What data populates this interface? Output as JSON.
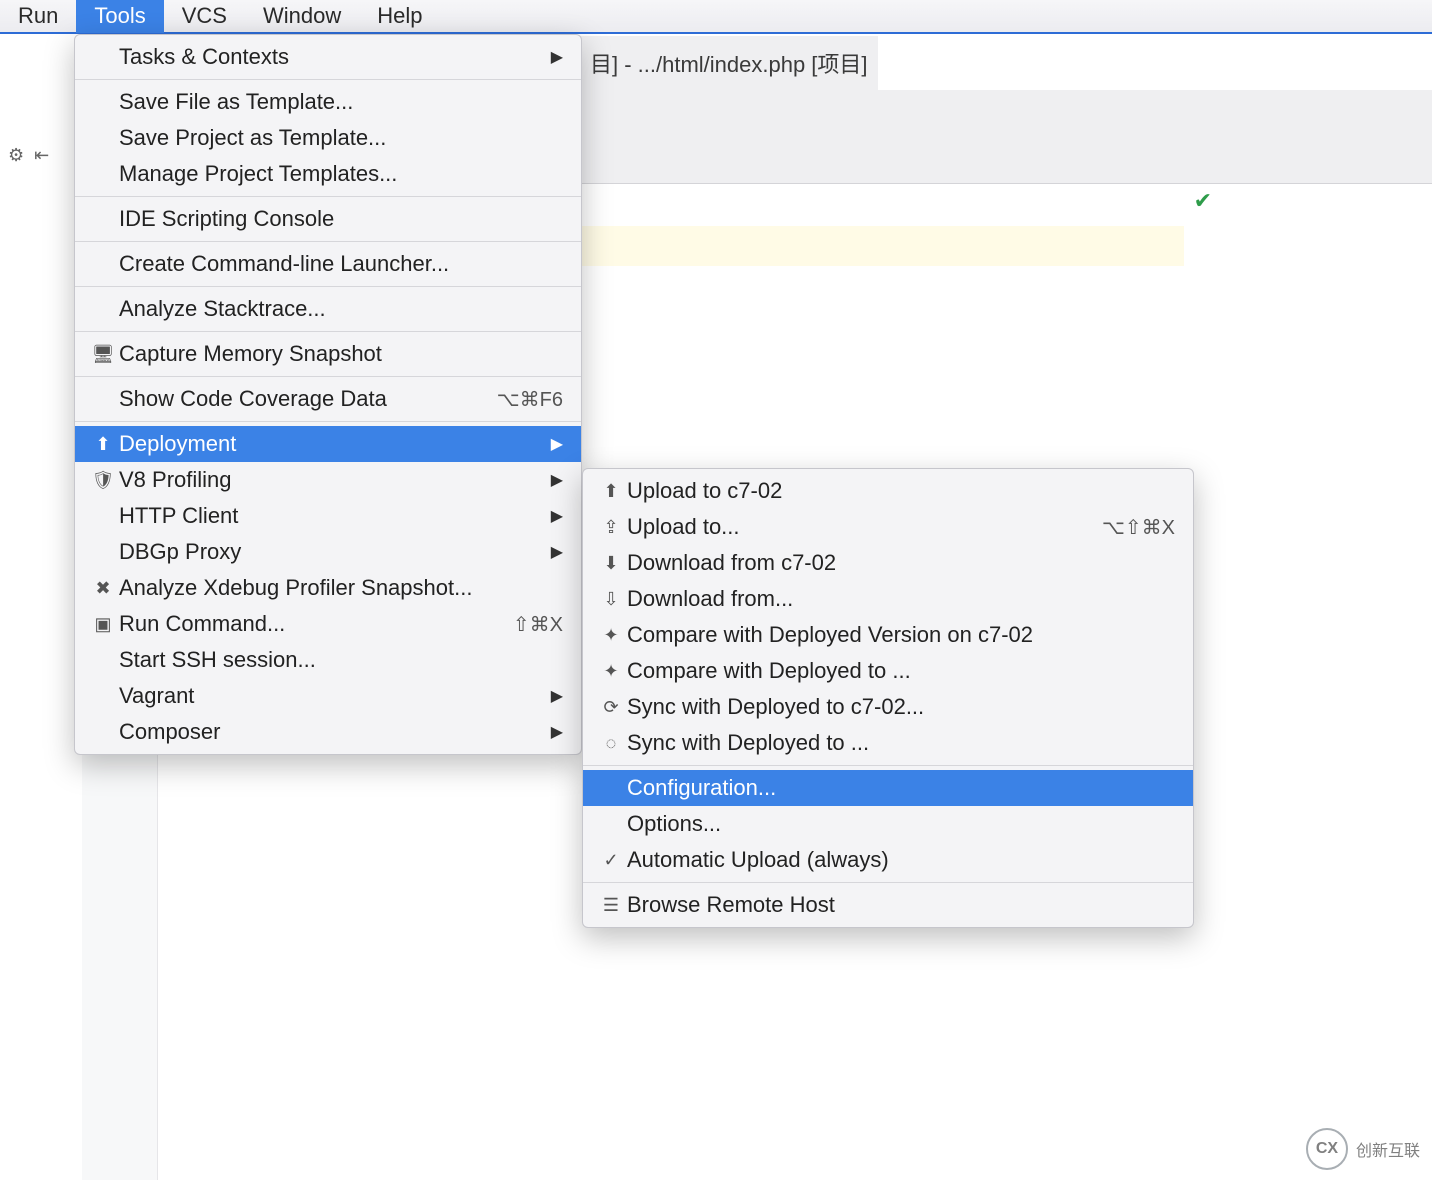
{
  "menubar": {
    "items": [
      "Run",
      "Tools",
      "VCS",
      "Window",
      "Help"
    ],
    "active_index": 1
  },
  "title_fragment": "目] - .../html/index.php [项目]",
  "tools_menu": {
    "groups": [
      [
        {
          "label": "Tasks & Contexts",
          "submenu": true
        }
      ],
      [
        {
          "label": "Save File as Template..."
        },
        {
          "label": "Save Project as Template..."
        },
        {
          "label": "Manage Project Templates..."
        }
      ],
      [
        {
          "label": "IDE Scripting Console"
        }
      ],
      [
        {
          "label": "Create Command-line Launcher..."
        }
      ],
      [
        {
          "label": "Analyze Stacktrace..."
        }
      ],
      [
        {
          "label": "Capture Memory Snapshot",
          "icon": "chip-icon"
        }
      ],
      [
        {
          "label": "Show Code Coverage Data",
          "shortcut": "⌥⌘F6"
        }
      ],
      [
        {
          "label": "Deployment",
          "icon": "deploy-icon",
          "submenu": true,
          "highlight": true
        },
        {
          "label": "V8 Profiling",
          "icon": "v8-icon",
          "submenu": true
        },
        {
          "label": "HTTP Client",
          "submenu": true
        },
        {
          "label": "DBGp Proxy",
          "submenu": true
        },
        {
          "label": "Analyze Xdebug Profiler Snapshot...",
          "icon": "xdebug-icon"
        },
        {
          "label": "Run Command...",
          "icon": "terminal-icon",
          "shortcut": "⇧⌘X"
        },
        {
          "label": "Start SSH session..."
        },
        {
          "label": "Vagrant",
          "submenu": true
        },
        {
          "label": "Composer",
          "submenu": true
        }
      ]
    ]
  },
  "deployment_menu": {
    "groups": [
      [
        {
          "label": "Upload to c7-02",
          "icon": "upload-icon"
        },
        {
          "label": "Upload to...",
          "icon": "upload-to-icon",
          "shortcut": "⌥⇧⌘X"
        },
        {
          "label": "Download from c7-02",
          "icon": "download-icon"
        },
        {
          "label": "Download from...",
          "icon": "download-from-icon"
        },
        {
          "label": "Compare with Deployed Version on c7-02",
          "icon": "compare-icon"
        },
        {
          "label": "Compare with Deployed to ...",
          "icon": "compare-icon"
        },
        {
          "label": "Sync with Deployed to c7-02...",
          "icon": "sync-icon"
        },
        {
          "label": "Sync with Deployed to ...",
          "icon": "sync-alt-icon"
        }
      ],
      [
        {
          "label": "Configuration...",
          "highlight": true
        },
        {
          "label": "Options..."
        },
        {
          "label": "Automatic Upload (always)",
          "checked": true
        }
      ],
      [
        {
          "label": "Browse Remote Host",
          "icon": "server-icon"
        }
      ]
    ]
  },
  "watermark": {
    "logo": "CX",
    "text": "创新互联"
  },
  "icons": {
    "chip-icon": "🖥",
    "deploy-icon": "⬆",
    "v8-icon": "🛡",
    "xdebug-icon": "✖",
    "terminal-icon": "▣",
    "upload-icon": "⬆",
    "upload-to-icon": "⇪",
    "download-icon": "⬇",
    "download-from-icon": "⇩",
    "compare-icon": "✦",
    "sync-icon": "⟳",
    "sync-alt-icon": "◌",
    "server-icon": "☰",
    "gear-icon": "⚙",
    "collapse-icon": "⇤"
  }
}
